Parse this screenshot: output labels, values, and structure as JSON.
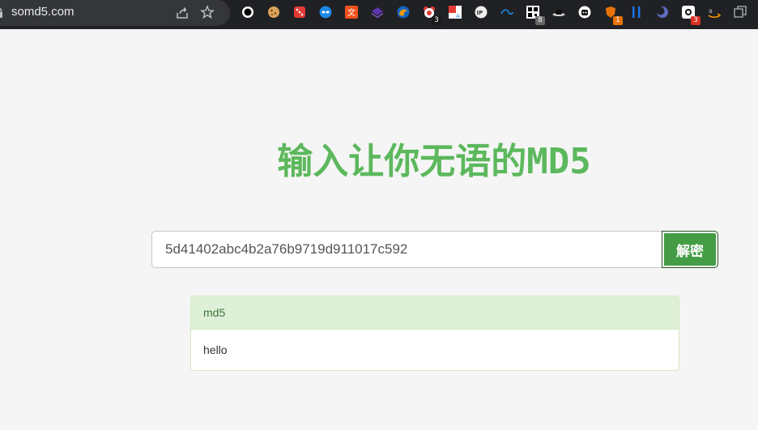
{
  "browser": {
    "url": "somd5.com",
    "extensions": [
      {
        "icon": "black-circle-icon",
        "badge": "",
        "badge_color": ""
      },
      {
        "icon": "cookie-icon",
        "badge": "",
        "badge_color": ""
      },
      {
        "icon": "red-dice-icon",
        "badge": "",
        "badge_color": ""
      },
      {
        "icon": "blue-mask-icon",
        "badge": "",
        "badge_color": ""
      },
      {
        "icon": "translate-icon",
        "badge": "",
        "badge_color": ""
      },
      {
        "icon": "purple-layers-icon",
        "badge": "",
        "badge_color": ""
      },
      {
        "icon": "firefox-like-icon",
        "badge": "",
        "badge_color": ""
      },
      {
        "icon": "red-bear-icon",
        "badge": "3",
        "badge_color": "#1a1a1a"
      },
      {
        "icon": "translate-box-icon",
        "badge": "",
        "badge_color": ""
      },
      {
        "icon": "ip-icon",
        "badge": "",
        "badge_color": ""
      },
      {
        "icon": "wave-icon",
        "badge": "",
        "badge_color": ""
      },
      {
        "icon": "qr-icon",
        "badge": "8",
        "badge_color": "#666666"
      },
      {
        "icon": "hat-icon",
        "badge": "",
        "badge_color": ""
      },
      {
        "icon": "robot-icon",
        "badge": "",
        "badge_color": ""
      },
      {
        "icon": "orange-shield-icon",
        "badge": "1",
        "badge_color": "#e8710a"
      },
      {
        "icon": "blue-bars-icon",
        "badge": "",
        "badge_color": ""
      },
      {
        "icon": "moon-icon",
        "badge": "",
        "badge_color": ""
      },
      {
        "icon": "camera-icon",
        "badge": "3",
        "badge_color": "#d93025"
      },
      {
        "icon": "amazon-icon",
        "badge": "",
        "badge_color": ""
      },
      {
        "icon": "window-icon",
        "badge": "",
        "badge_color": ""
      }
    ]
  },
  "page": {
    "title": "输入让你无语的MD5",
    "search": {
      "value": "5d41402abc4b2a76b9719d911017c592"
    },
    "decrypt_label": "解密",
    "result": {
      "heading": "md5",
      "body": "hello"
    }
  },
  "colors": {
    "title": "#5cb85c",
    "button": "#449d44",
    "panel_heading": "#dff0d8"
  }
}
